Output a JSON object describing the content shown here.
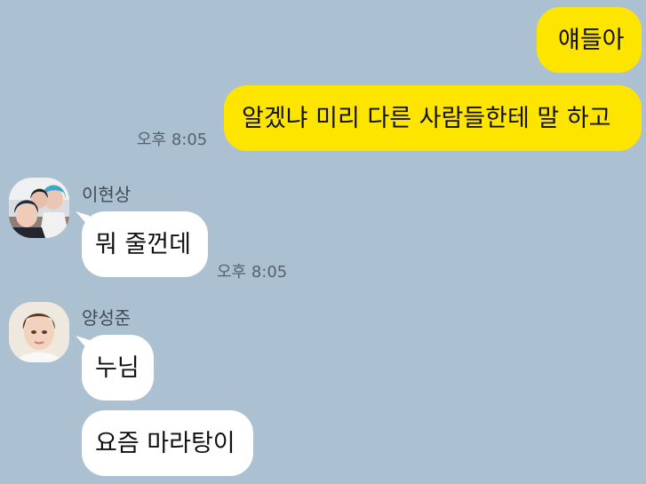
{
  "colors": {
    "background": "#abc1d1",
    "my_bubble": "#fee500",
    "their_bubble": "#ffffff"
  },
  "messages": {
    "outgoing_1": "얘들아",
    "outgoing_2": "알겠냐 미리 다른 사람들한테 말 하고",
    "outgoing_time": "오후 8:05",
    "lee_name": "이현상",
    "lee_message": "뭐 줄껀데",
    "lee_time": "오후 8:05",
    "yang_name": "양성준",
    "yang_message_1": "누님",
    "yang_message_2": "요즘 마라탕이"
  }
}
